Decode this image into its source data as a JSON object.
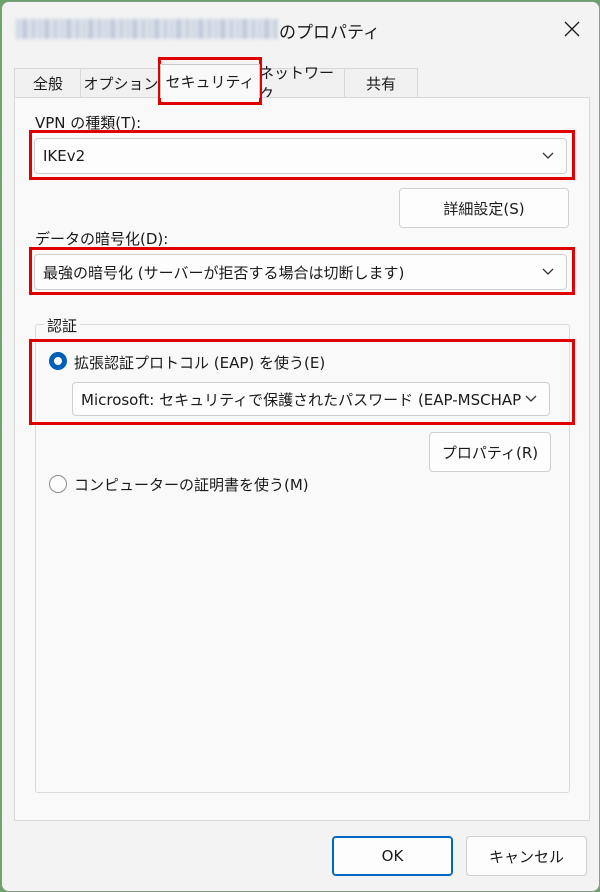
{
  "window": {
    "title_suffix": "のプロパティ"
  },
  "tabs": [
    {
      "label": "全般"
    },
    {
      "label": "オプション"
    },
    {
      "label": "セキュリティ",
      "selected": true
    },
    {
      "label": "ネットワーク"
    },
    {
      "label": "共有"
    }
  ],
  "vpn_type": {
    "label": "VPN の種類(T):",
    "value": "IKEv2"
  },
  "advanced_button": {
    "label": "詳細設定(S)"
  },
  "encryption": {
    "label": "データの暗号化(D):",
    "value": "最強の暗号化 (サーバーが拒否する場合は切断します)"
  },
  "auth": {
    "group_title": "認証",
    "eap_radio": {
      "label": "拡張認証プロトコル (EAP) を使う(E)",
      "checked": true
    },
    "eap_method": {
      "value": "Microsoft: セキュリティで保護されたパスワード (EAP-MSCHAP"
    },
    "properties_button": {
      "label": "プロパティ(R)"
    },
    "cert_radio": {
      "label": "コンピューターの証明書を使う(M)",
      "checked": false
    }
  },
  "footer": {
    "ok_label": "OK",
    "cancel_label": "キャンセル"
  },
  "colors": {
    "highlight": "#e00000",
    "accent": "#005fb8"
  },
  "icons": {
    "close": "close-icon",
    "dropdown": "chevron-down-icon"
  }
}
